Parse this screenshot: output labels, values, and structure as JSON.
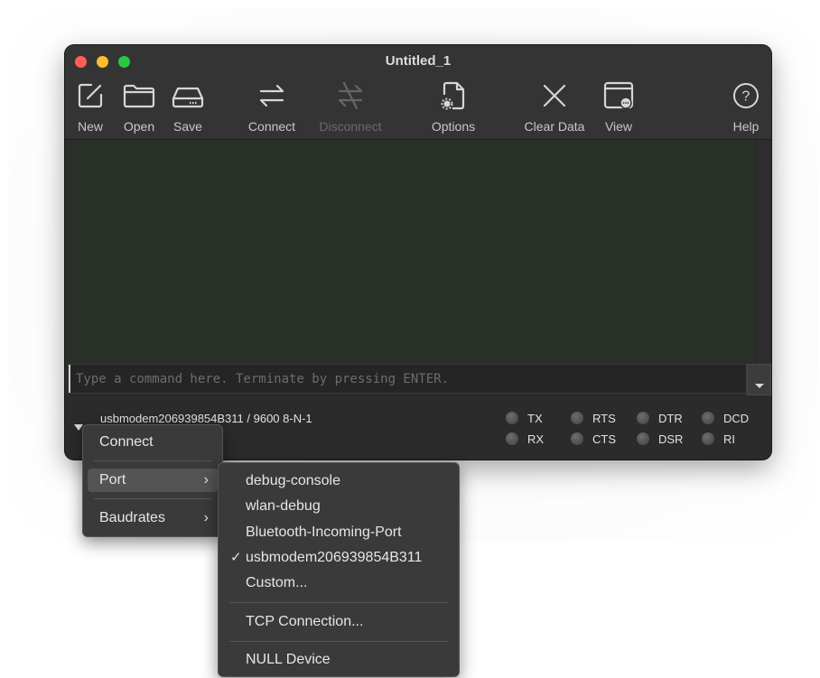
{
  "window": {
    "title": "Untitled_1"
  },
  "toolbar": {
    "new": "New",
    "open": "Open",
    "save": "Save",
    "connect": "Connect",
    "disconnect": "Disconnect",
    "options": "Options",
    "clear_data": "Clear Data",
    "view": "View",
    "help": "Help"
  },
  "command": {
    "placeholder": "Type a command here. Terminate by pressing ENTER."
  },
  "status": {
    "port_info": "usbmodem206939854B311 / 9600 8-N-1",
    "signals": [
      "TX",
      "RX",
      "RTS",
      "CTS",
      "DTR",
      "DSR",
      "DCD",
      "RI"
    ]
  },
  "menu": {
    "connect": "Connect",
    "port": "Port",
    "baudrates": "Baudrates",
    "chevron": "›"
  },
  "port_menu": {
    "items": [
      "debug-console",
      "wlan-debug",
      "Bluetooth-Incoming-Port",
      "usbmodem206939854B311",
      "Custom..."
    ],
    "checked_item": "usbmodem206939854B311",
    "check_glyph": "✓",
    "tcp": "TCP Connection...",
    "null_device": "NULL Device"
  }
}
